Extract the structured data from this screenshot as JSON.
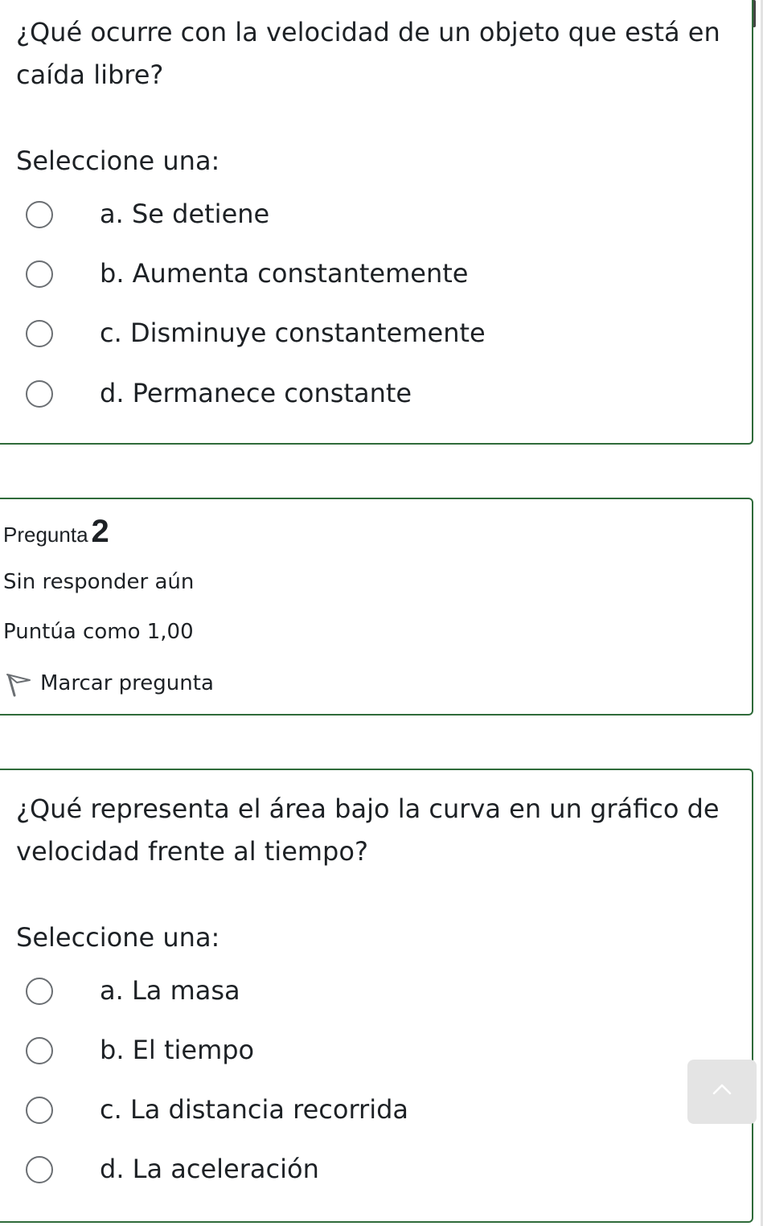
{
  "question1": {
    "text": "¿Qué ocurre con la velocidad de un objeto que está en caída libre?",
    "prompt": "Seleccione una:",
    "options": [
      {
        "label": "a. Se detiene"
      },
      {
        "label": "b. Aumenta constantemente"
      },
      {
        "label": "c. Disminuye constantemente"
      },
      {
        "label": "d. Permanece constante"
      }
    ]
  },
  "question2_info": {
    "word": "Pregunta",
    "number": "2",
    "state": "Sin responder aún",
    "grade": "Puntúa como 1,00",
    "flag_label": "Marcar pregunta",
    "flag_icon": "flag-icon"
  },
  "question2": {
    "text": "¿Qué representa el área bajo la curva en un gráfico de velocidad frente al tiempo?",
    "prompt": "Seleccione una:",
    "options": [
      {
        "label": "a. La masa"
      },
      {
        "label": "b. El tiempo"
      },
      {
        "label": "c. La distancia recorrida"
      },
      {
        "label": "d. La aceleración"
      }
    ]
  },
  "back_to_top": {
    "icon": "chevron-up-icon"
  },
  "colors": {
    "border": "#2f6b3a",
    "radio_border": "#6b6f73",
    "button_bg": "#e4e4e4"
  }
}
